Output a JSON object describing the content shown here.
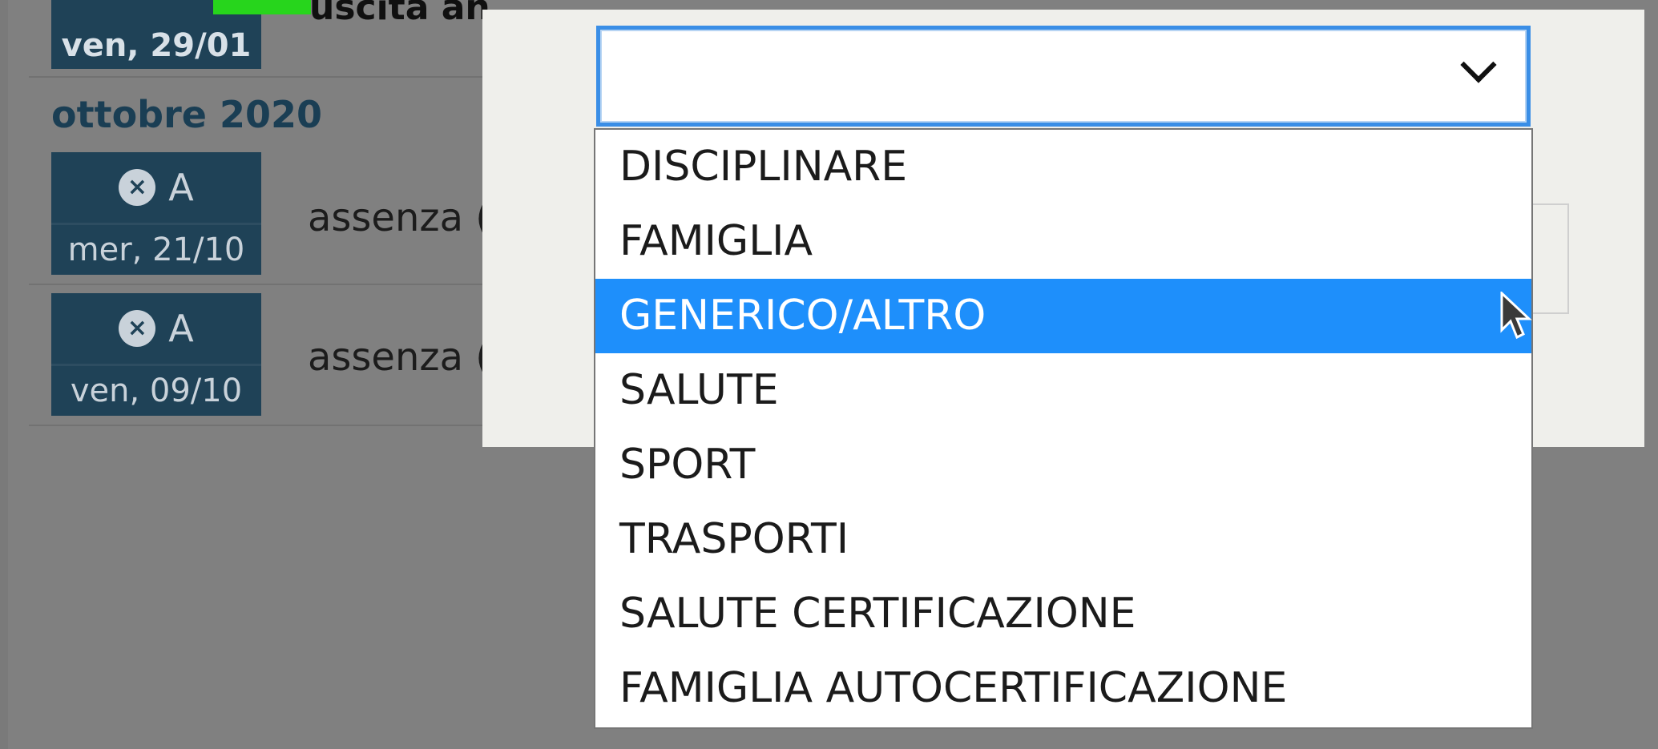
{
  "background_list": {
    "top_entry": {
      "date": "ven, 29/01",
      "text": "uscita an"
    },
    "month_title": "ottobre 2020",
    "entries": [
      {
        "type": "A",
        "date": "mer, 21/10",
        "text": "assenza ("
      },
      {
        "type": "A",
        "date": "ven, 09/10",
        "text": "assenza ("
      }
    ]
  },
  "select": {
    "value": "",
    "options": [
      "DISCIPLINARE",
      "FAMIGLIA",
      "GENERICO/ALTRO",
      "SALUTE",
      "SPORT",
      "TRASPORTI",
      "SALUTE CERTIFICAZIONE",
      "FAMIGLIA AUTOCERTIFICAZIONE"
    ],
    "highlighted_option": "GENERICO/ALTRO"
  },
  "colors": {
    "accent": "#1e8ffb",
    "badge": "#1f4257",
    "overlay": "#808080"
  }
}
